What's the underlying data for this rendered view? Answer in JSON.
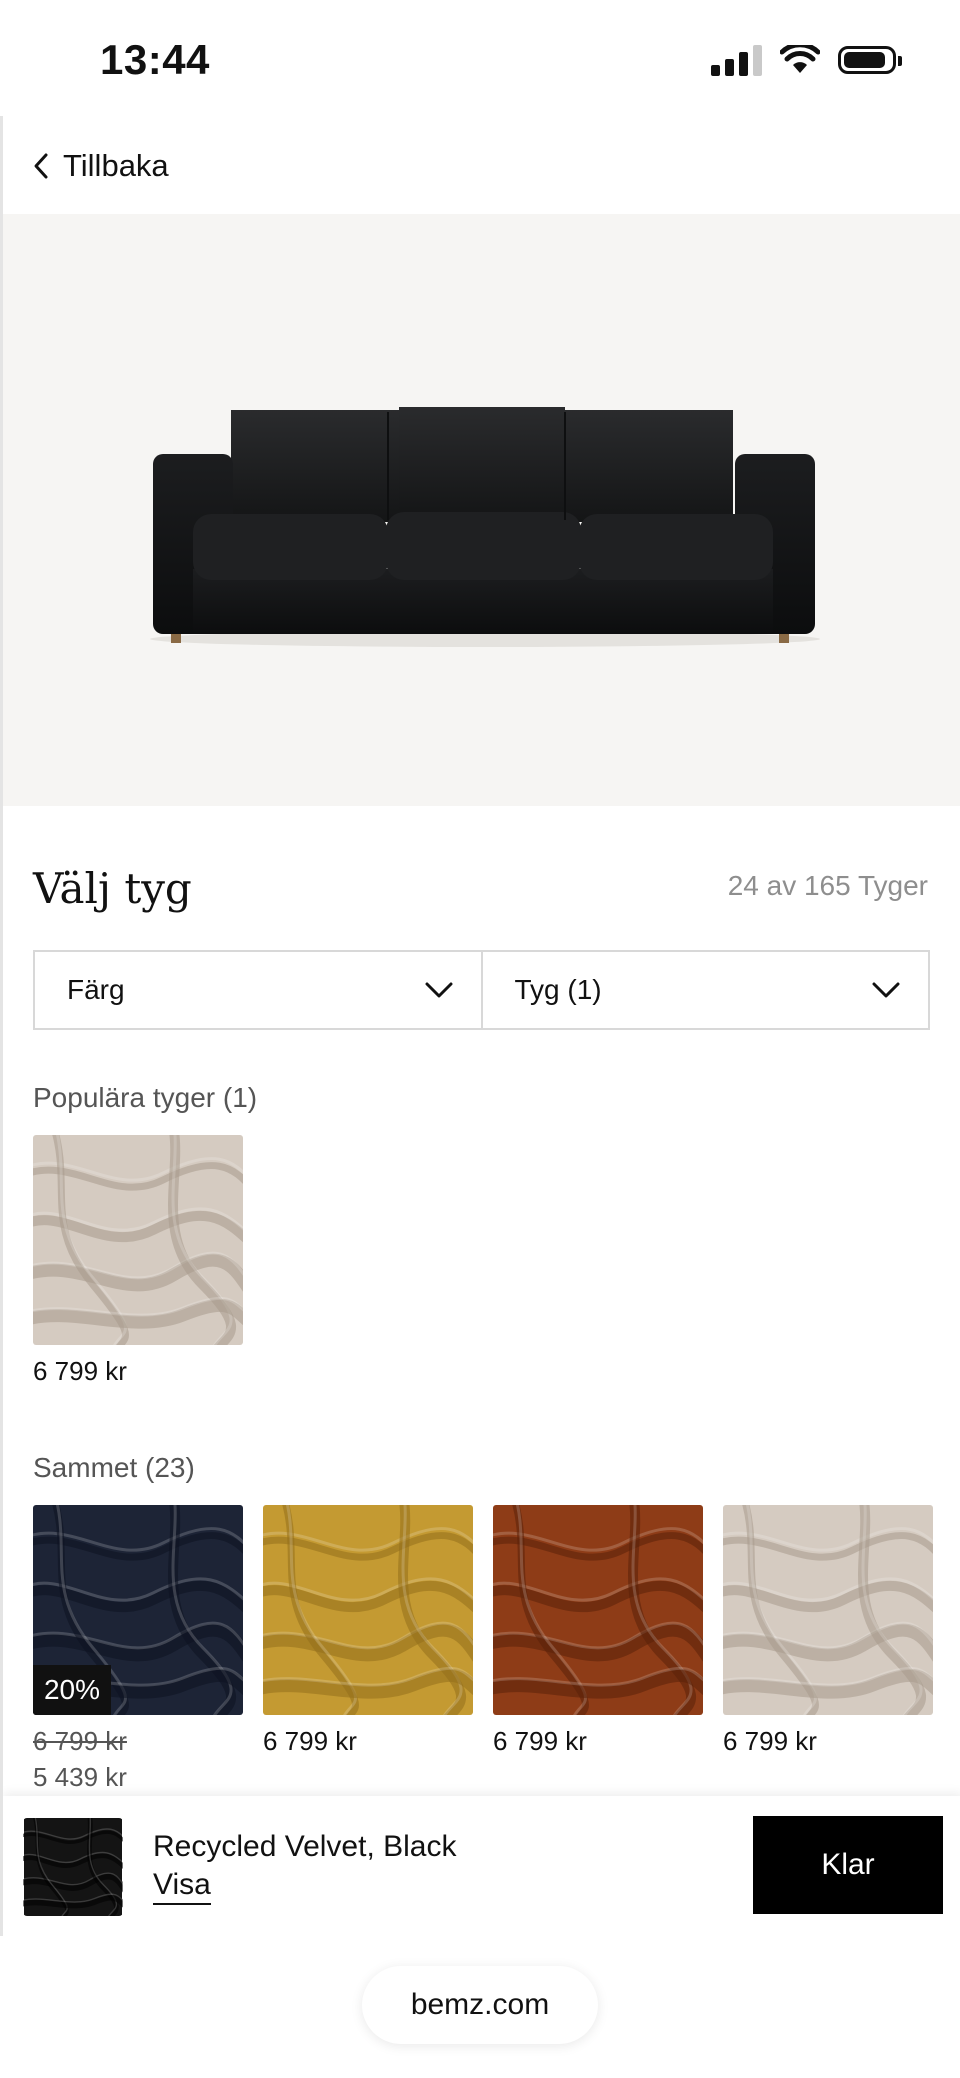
{
  "status_bar": {
    "time": "13:44",
    "battery_level": 0.9
  },
  "nav": {
    "back_label": "Tillbaka"
  },
  "product": {
    "image": "black-velvet-3-seat-sofa"
  },
  "fabric_picker": {
    "title": "Välj tyg",
    "count": "24 av 165 Tyger",
    "filters": [
      {
        "label": "Färg"
      },
      {
        "label": "Tyg (1)"
      }
    ],
    "groups": [
      {
        "title": "Populära tyger (1)",
        "swatches": [
          {
            "color": "#d5cbc1",
            "shade": "#a89a8c",
            "price": "6 799 kr"
          }
        ]
      },
      {
        "title": "Sammet (23)",
        "swatches": [
          {
            "color": "#1d2436",
            "shade": "#0d1220",
            "badge": "20%",
            "price": "6 799 kr",
            "price_struck": true
          },
          {
            "color": "#c49a32",
            "shade": "#94701c",
            "price": "6 799 kr"
          },
          {
            "color": "#8e3c17",
            "shade": "#5a200a",
            "price": "6 799 kr"
          },
          {
            "color": "#d5cbc1",
            "shade": "#a89a8c",
            "price": "6 799 kr"
          }
        ],
        "cut_off_text": "5 439 kr"
      }
    ]
  },
  "selection_bar": {
    "thumb_color": "#141414",
    "name": "Recycled Velvet, Black",
    "show_label": "Visa",
    "done_label": "Klar"
  },
  "browser": {
    "url": "bemz.com"
  }
}
